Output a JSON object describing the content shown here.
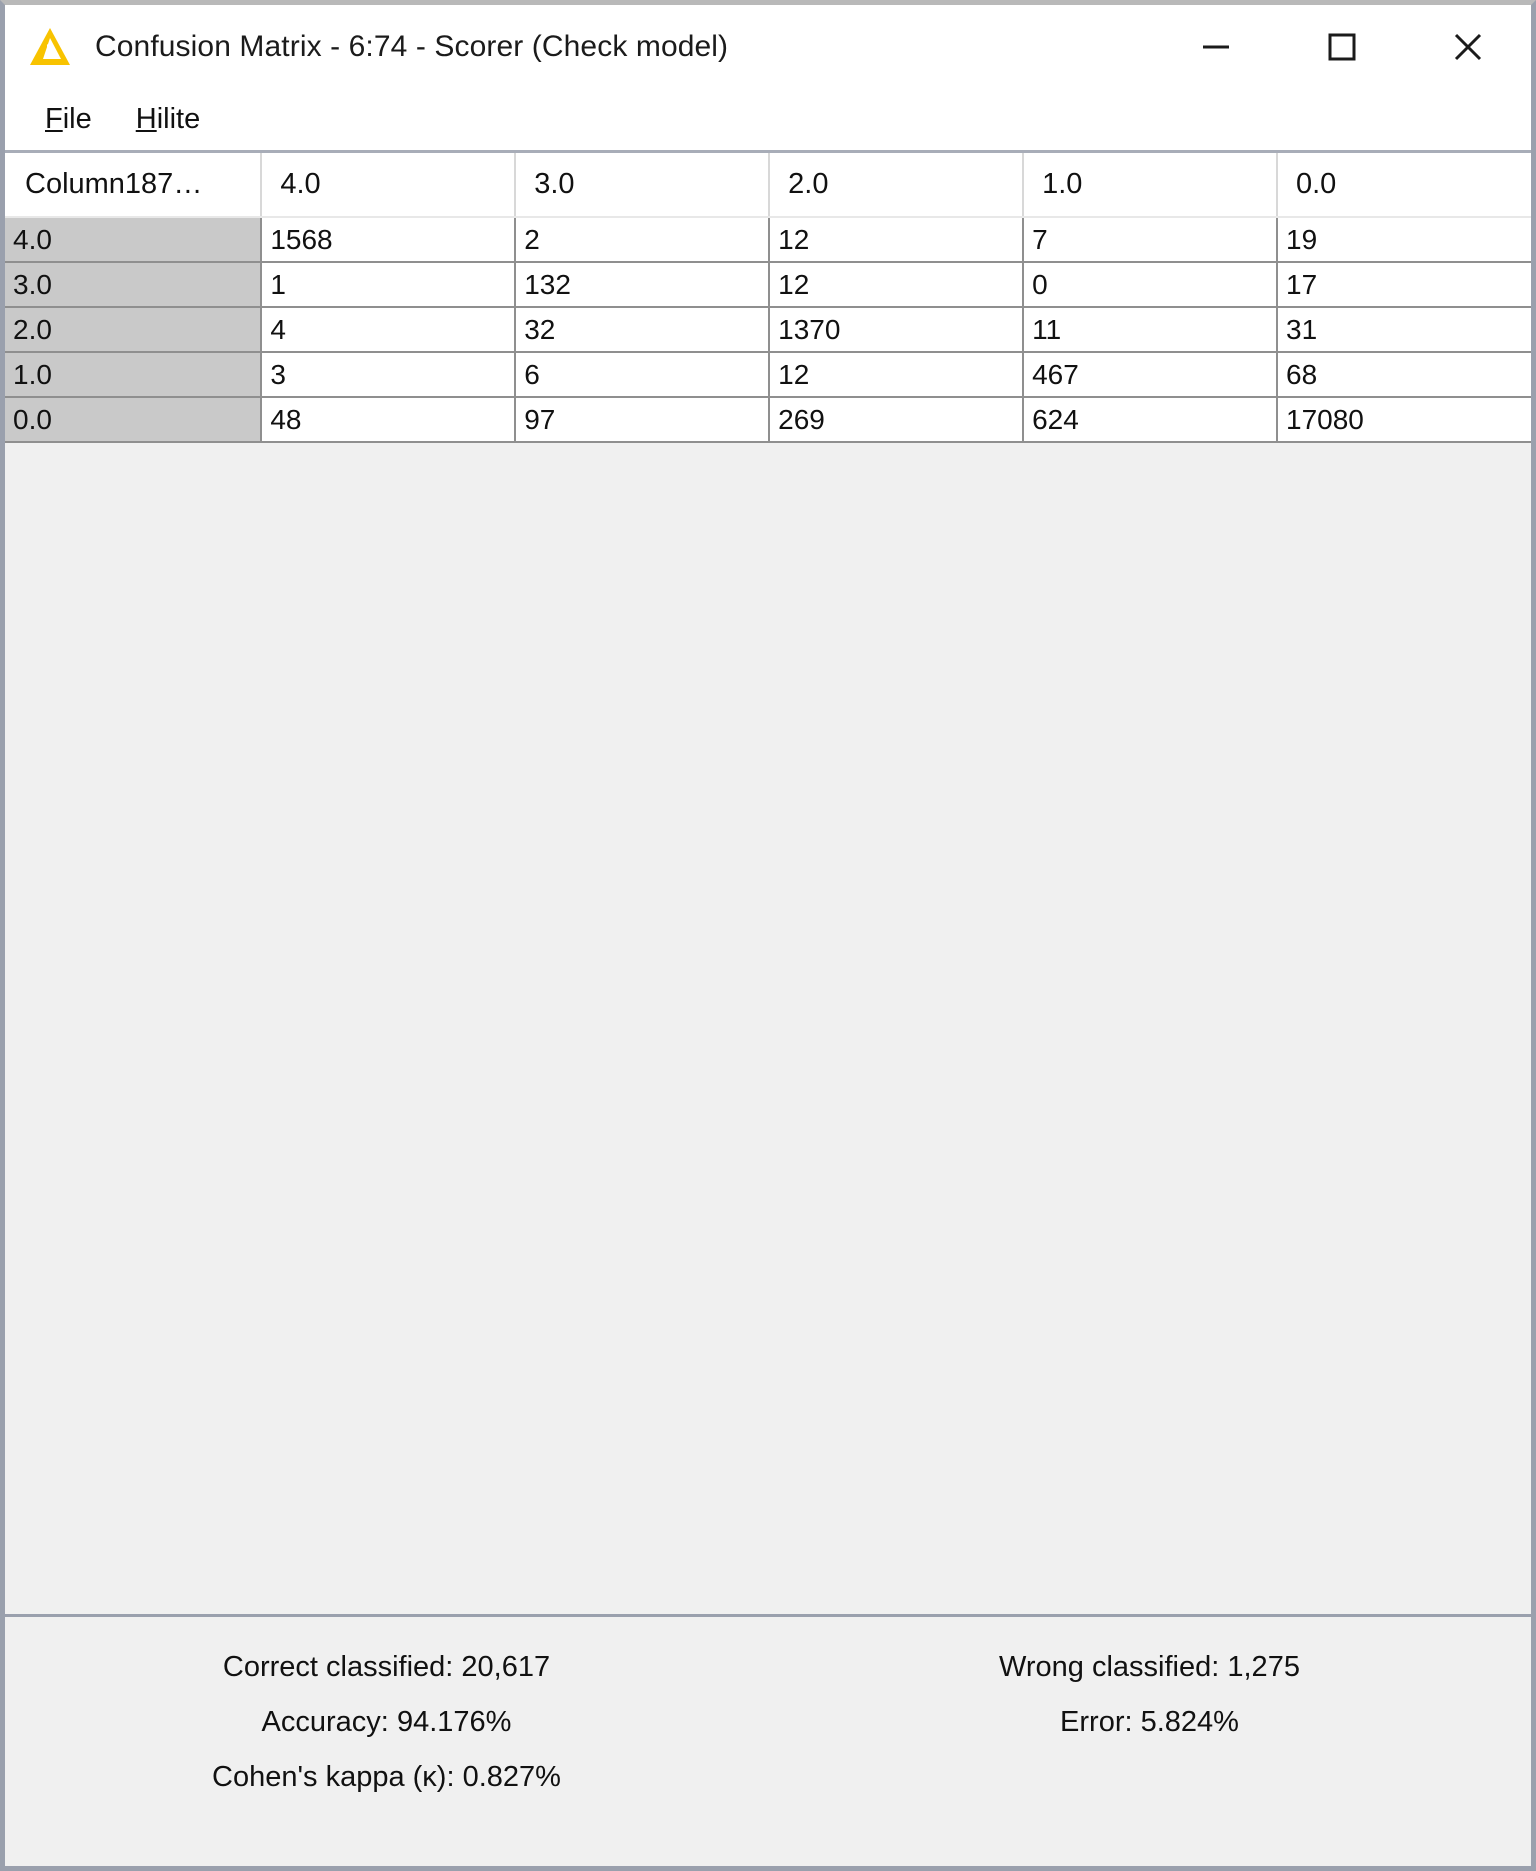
{
  "window": {
    "title": "Confusion Matrix - 6:74 - Scorer (Check model)",
    "icon": "knime-triangle-icon",
    "controls": {
      "minimize": "minimize-icon",
      "maximize": "maximize-icon",
      "close": "close-icon"
    }
  },
  "menubar": {
    "items": [
      {
        "label": "File",
        "mnemonic": "F",
        "rest": "ile"
      },
      {
        "label": "Hilite",
        "mnemonic": "H",
        "rest": "ilite"
      }
    ]
  },
  "table": {
    "corner_header": "Column187…",
    "column_headers": [
      "4.0",
      "3.0",
      "2.0",
      "1.0",
      "0.0"
    ],
    "row_headers": [
      "4.0",
      "3.0",
      "2.0",
      "1.0",
      "0.0"
    ],
    "rows": [
      [
        "1568",
        "2",
        "12",
        "7",
        "19"
      ],
      [
        "1",
        "132",
        "12",
        "0",
        "17"
      ],
      [
        "4",
        "32",
        "1370",
        "11",
        "31"
      ],
      [
        "3",
        "6",
        "12",
        "467",
        "68"
      ],
      [
        "48",
        "97",
        "269",
        "624",
        "17080"
      ]
    ]
  },
  "stats": {
    "correct_label": "Correct classified:",
    "correct_value": "20,617",
    "wrong_label": "Wrong classified:",
    "wrong_value": "1,275",
    "accuracy_label": "Accuracy:",
    "accuracy_value": "94.176%",
    "error_label": "Error:",
    "error_value": "5.824%",
    "kappa_label": "Cohen's kappa (κ):",
    "kappa_value": "0.827%"
  },
  "colors": {
    "accent": "#f8c300",
    "row_header_bg": "#c9c9c9",
    "panel_bg": "#f0f0f0",
    "grid_line": "#8f8f8f"
  }
}
